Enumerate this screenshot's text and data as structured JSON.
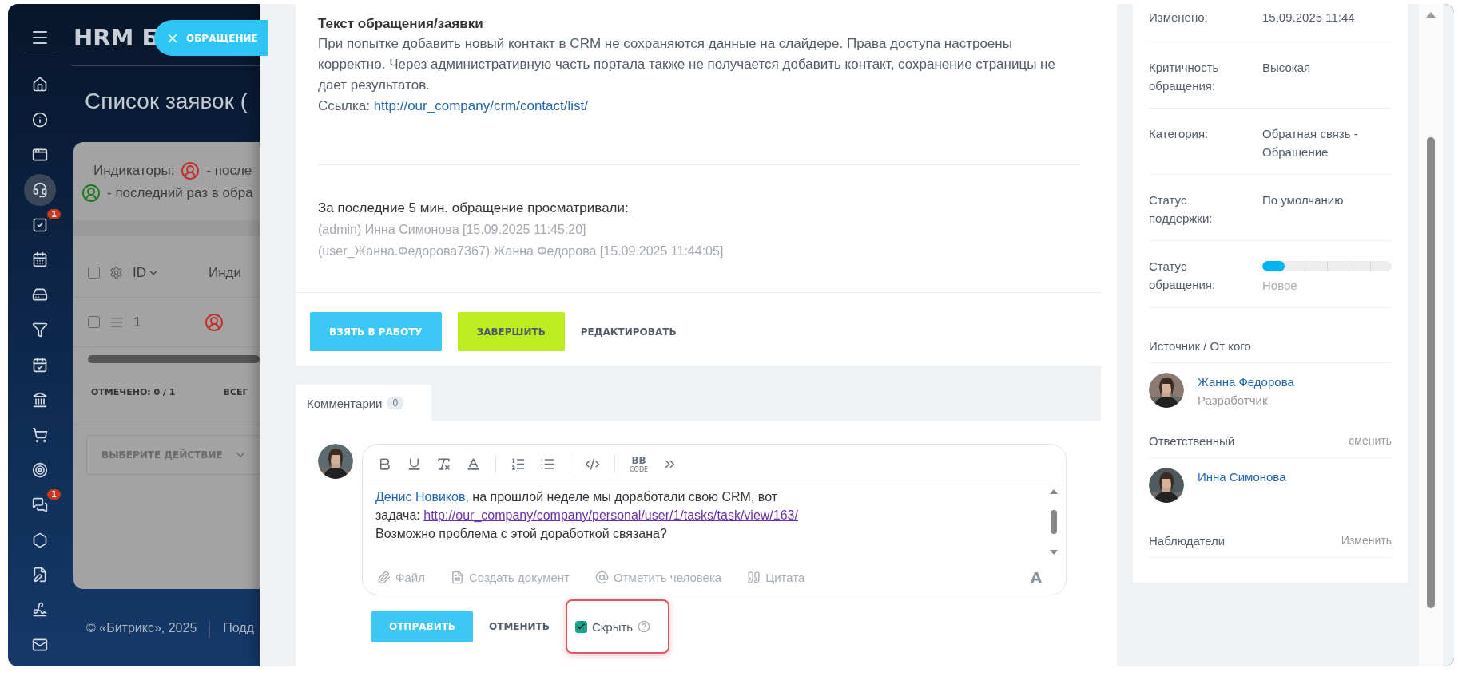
{
  "sidebar": {
    "items": [
      {
        "kind": "home",
        "selected": false
      },
      {
        "kind": "info",
        "selected": false
      },
      {
        "kind": "window",
        "selected": false
      },
      {
        "kind": "support",
        "selected": true
      },
      {
        "kind": "tasks",
        "selected": false,
        "badge": "1"
      },
      {
        "kind": "calendar",
        "selected": false
      },
      {
        "kind": "drive",
        "selected": false
      },
      {
        "kind": "funnel",
        "selected": false
      },
      {
        "kind": "plan",
        "selected": false
      },
      {
        "kind": "bank",
        "selected": false
      },
      {
        "kind": "cart",
        "selected": false
      },
      {
        "kind": "target",
        "selected": false
      },
      {
        "kind": "chat",
        "selected": false,
        "badge": "1"
      },
      {
        "kind": "hexagon",
        "selected": false
      },
      {
        "kind": "document",
        "selected": false
      },
      {
        "kind": "sign",
        "selected": false
      },
      {
        "kind": "mail",
        "selected": false
      }
    ]
  },
  "background_page": {
    "app_title": "HRM Б",
    "page_title": "Список заявок (",
    "indicators": {
      "label": "Индикаторы:",
      "items": [
        {
          "text": "- после",
          "color": "#c0302e"
        },
        {
          "text": "- последний раз в обра",
          "color": "#1f7a22"
        }
      ]
    },
    "table": {
      "header_checked": false,
      "columns": [
        "ID",
        "Инди"
      ],
      "rows": [
        {
          "id": "1",
          "checked": false
        }
      ]
    },
    "selected_label": "ОТМЕЧЕНО:",
    "selected_value": "0 / 1",
    "total_label": "ВСЕГ",
    "action_placeholder": "ВЫБЕРИТЕ ДЕЙСТВИЕ",
    "copyright": "© «Битрикс», 2025",
    "support_link": "Подд"
  },
  "slider_tab": {
    "label": "ОБРАЩЕНИЕ"
  },
  "request": {
    "heading": "Текст обращения/заявки",
    "body": "При попытке добавить новый контакт в CRM не сохраняются данные на слайдере. Права доступа настроены корректно. Через административную часть портала также не получается добавить контакт, сохранение страницы не дает результатов.",
    "link_label": "Ссылка:",
    "link": "http://our_company/crm/contact/list/"
  },
  "viewers": {
    "heading": "За последние 5 мин. обращение просматривали:",
    "entries": [
      "(admin) Инна Симонова [15.09.2025 11:45:20]",
      "(user_Жанна.Федорова7367) Жанна Федорова [15.09.2025 11:44:05]"
    ]
  },
  "actions": [
    {
      "label": "ВЗЯТЬ В РАБОТУ",
      "kind": "primary"
    },
    {
      "label": "ЗАВЕРШИТЬ",
      "kind": "success"
    },
    {
      "label": "РЕДАКТИРОВАТЬ",
      "kind": "link"
    }
  ],
  "comments_tab": {
    "label": "Комментарии",
    "count": "0",
    "selected": true
  },
  "editor": {
    "toolbar": [
      {
        "kind": "bold"
      },
      {
        "kind": "underline"
      },
      {
        "kind": "clear"
      },
      {
        "kind": "color"
      },
      {
        "kind": "divider"
      },
      {
        "kind": "ordered"
      },
      {
        "kind": "bulleted"
      },
      {
        "kind": "divider"
      },
      {
        "kind": "code"
      },
      {
        "kind": "divider"
      },
      {
        "kind": "bbcode",
        "label": "BB",
        "sublabel": "CODE"
      },
      {
        "kind": "more"
      }
    ],
    "mention": "Денис Новиков,",
    "line_1": " на прошлой неделе мы доработали свою CRM, вот",
    "link_prefix": "задача: ",
    "link": "http://our_company/company/personal/user/1/tasks/task/view/163/",
    "line_3": "Возможно проблема с этой доработкой связана?",
    "attachments": [
      {
        "kind": "file",
        "label": "Файл"
      },
      {
        "kind": "document",
        "label": "Создать документ"
      },
      {
        "kind": "mention",
        "label": "Отметить человека"
      },
      {
        "kind": "quote",
        "label": "Цитата"
      }
    ],
    "font_button": "A"
  },
  "send": {
    "submit": "ОТПРАВИТЬ",
    "cancel": "ОТМЕНИТЬ",
    "hide": {
      "label": "Скрыть",
      "checked": true,
      "highlighted": true
    }
  },
  "properties": [
    {
      "kind": "text",
      "label": "Изменено:",
      "value": "15.09.2025 11:44"
    },
    {
      "kind": "text",
      "label": "Критичность обращения:",
      "value": "Высокая"
    },
    {
      "kind": "text",
      "label": "Категория:",
      "value": "Обратная связь - Обращение"
    },
    {
      "kind": "text",
      "label": "Статус поддержки:",
      "value": "По умолчанию"
    },
    {
      "kind": "progress",
      "label": "Статус обращения:",
      "level": 0.17,
      "value": "Новое"
    }
  ],
  "source": {
    "heading": "Источник / От кого",
    "name": "Жанна Федорова",
    "role": "Разработчик"
  },
  "responsible": {
    "heading": "Ответственный",
    "action": "сменить",
    "name": "Инна Симонова"
  },
  "observers": {
    "heading": "Наблюдатели",
    "action": "Изменить"
  }
}
